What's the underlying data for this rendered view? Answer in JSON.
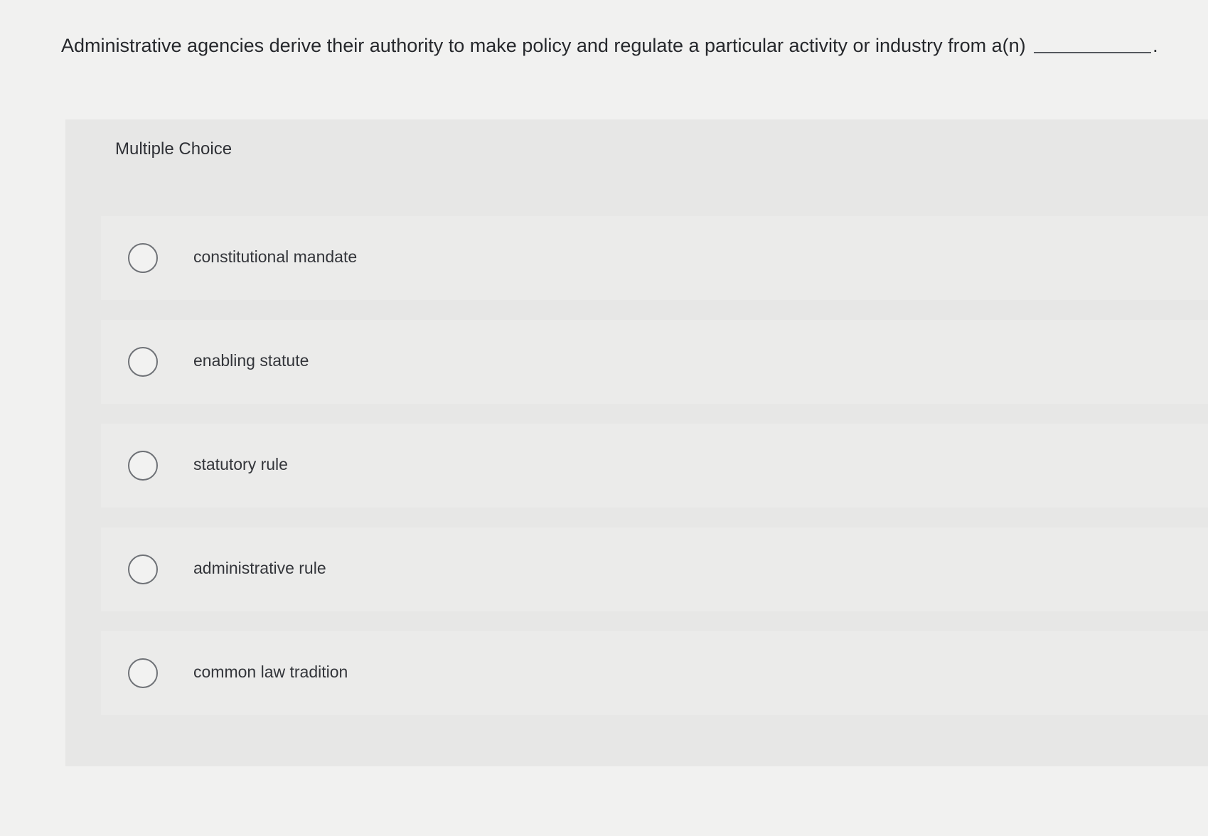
{
  "question": {
    "text": "Administrative agencies derive their authority to make policy and regulate a particular activity or industry from a(n)",
    "end_punctuation": "."
  },
  "multiple_choice": {
    "header": "Multiple Choice",
    "options": [
      {
        "label": "constitutional mandate",
        "selected": false
      },
      {
        "label": "enabling statute",
        "selected": false
      },
      {
        "label": "statutory rule",
        "selected": false
      },
      {
        "label": "administrative rule",
        "selected": false
      },
      {
        "label": "common law tradition",
        "selected": false
      }
    ]
  }
}
